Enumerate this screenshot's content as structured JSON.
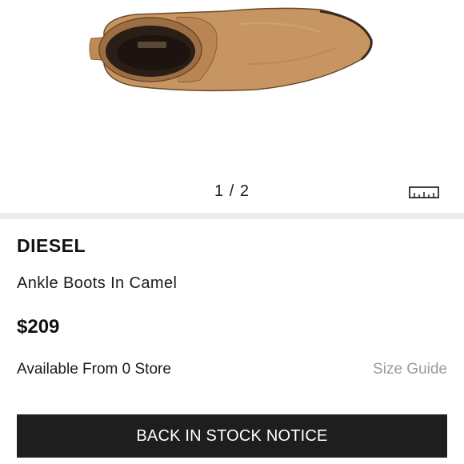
{
  "gallery": {
    "image_alt": "Ankle boots in camel suede, top view",
    "pager_text": "1 / 2",
    "size_icon": "ruler-icon"
  },
  "product": {
    "brand": "DIESEL",
    "name": "Ankle Boots In Camel",
    "price": "$209",
    "availability": "Available From 0 Store",
    "size_guide_label": "Size Guide"
  },
  "actions": {
    "notice_label": "BACK IN STOCK NOTICE"
  },
  "colors": {
    "button_bg": "#1e1e1e",
    "divider": "#ececec",
    "muted_text": "#9a9a9a",
    "suede": "#c69561"
  }
}
